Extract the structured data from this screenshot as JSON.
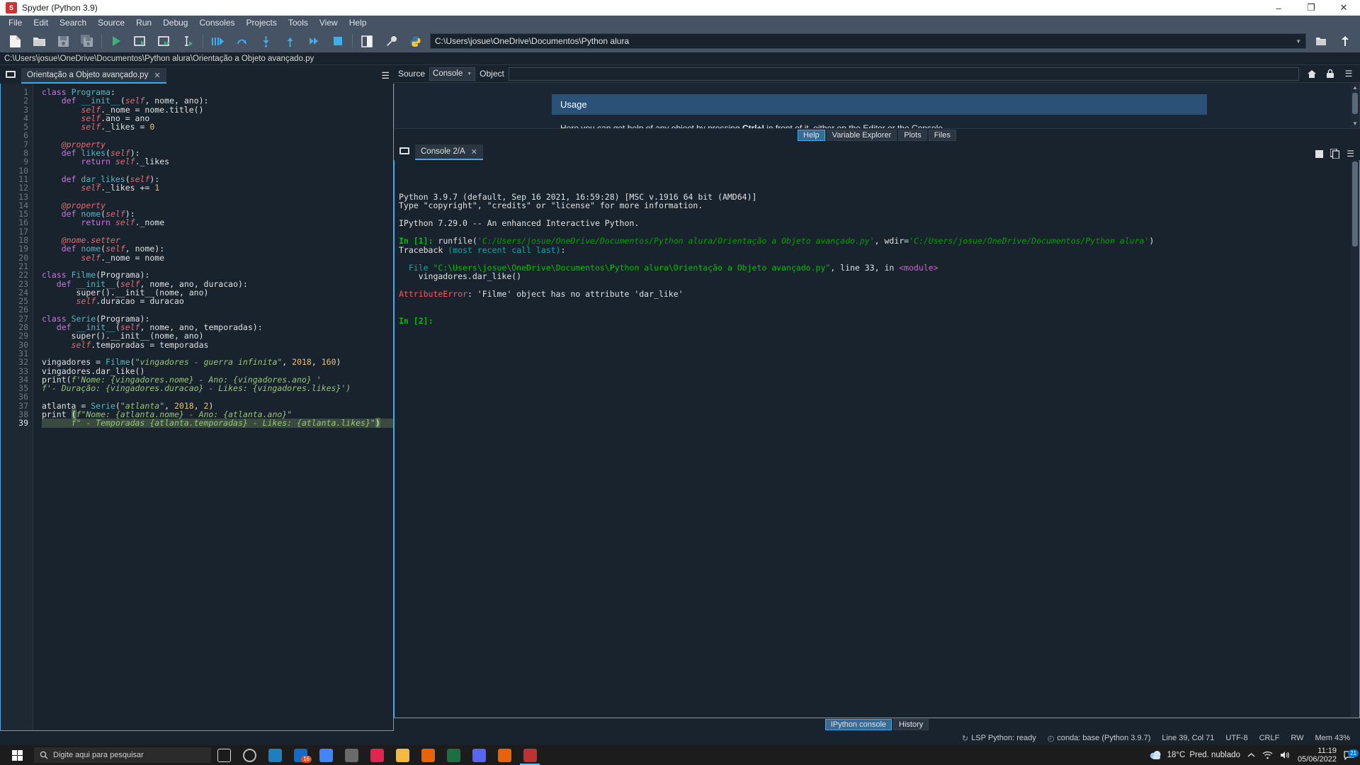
{
  "window": {
    "title": "Spyder (Python 3.9)",
    "app_icon": "spyder-icon",
    "minimize_label": "–",
    "maximize_label": "❐",
    "close_label": "✕"
  },
  "menubar": {
    "items": [
      "File",
      "Edit",
      "Search",
      "Source",
      "Run",
      "Debug",
      "Consoles",
      "Projects",
      "Tools",
      "View",
      "Help"
    ]
  },
  "toolbar": {
    "buttons": [
      {
        "name": "new-file-icon",
        "title": "New file"
      },
      {
        "name": "open-file-icon",
        "title": "Open file"
      },
      {
        "name": "save-file-icon",
        "title": "Save file"
      },
      {
        "name": "save-all-icon",
        "title": "Save all"
      },
      {
        "name": "run-file-icon",
        "title": "Run file"
      },
      {
        "name": "run-cell-icon",
        "title": "Run cell"
      },
      {
        "name": "run-cell-advance-icon",
        "title": "Run cell and advance"
      },
      {
        "name": "run-selection-icon",
        "title": "Run selection"
      },
      {
        "name": "debug-file-icon",
        "title": "Debug file"
      },
      {
        "name": "step-over-icon",
        "title": "Run current line"
      },
      {
        "name": "step-into-icon",
        "title": "Step into function"
      },
      {
        "name": "step-return-icon",
        "title": "Run until exit"
      },
      {
        "name": "continue-icon",
        "title": "Continue execution"
      },
      {
        "name": "stop-debug-icon",
        "title": "Stop debugging"
      },
      {
        "name": "maximize-pane-icon",
        "title": "Maximize current pane"
      },
      {
        "name": "preferences-icon",
        "title": "Preferences"
      },
      {
        "name": "python-path-icon",
        "title": "PYTHONPATH manager"
      }
    ],
    "path_value": "C:\\Users\\josue\\OneDrive\\Documentos\\Python alura",
    "browse_icon": "folder-icon",
    "parent_dir_icon": "arrow-up-icon",
    "dropdown_icon": "chevron-down-icon"
  },
  "editor": {
    "filepath": "C:\\Users\\josue\\OneDrive\\Documentos\\Python alura\\Orientação a Objeto avançado.py",
    "browse_tabs_icon": "browse-tabs-icon",
    "options_icon": "hamburger-icon",
    "tab": {
      "label": "Orientação a Objeto avançado.py",
      "close": "✕"
    },
    "lines": [
      {
        "n": 1,
        "tokens": [
          [
            "kw",
            "class"
          ],
          [
            "op",
            " "
          ],
          [
            "cls",
            "Programa"
          ],
          [
            "op",
            ":"
          ]
        ]
      },
      {
        "n": 2,
        "tokens": [
          [
            "op",
            "    "
          ],
          [
            "kw",
            "def"
          ],
          [
            "op",
            " "
          ],
          [
            "fn",
            "__init__"
          ],
          [
            "op",
            "("
          ],
          [
            "self",
            "self"
          ],
          [
            "op",
            ", nome, ano):"
          ]
        ]
      },
      {
        "n": 3,
        "tokens": [
          [
            "op",
            "        "
          ],
          [
            "self",
            "self"
          ],
          [
            "op",
            "._nome = nome.title()"
          ]
        ]
      },
      {
        "n": 4,
        "tokens": [
          [
            "op",
            "        "
          ],
          [
            "self",
            "self"
          ],
          [
            "op",
            ".ano = ano"
          ]
        ]
      },
      {
        "n": 5,
        "tokens": [
          [
            "op",
            "        "
          ],
          [
            "self",
            "self"
          ],
          [
            "op",
            "._likes = "
          ],
          [
            "num",
            "0"
          ]
        ]
      },
      {
        "n": 6,
        "tokens": []
      },
      {
        "n": 7,
        "tokens": [
          [
            "op",
            "    "
          ],
          [
            "dec",
            "@property"
          ]
        ]
      },
      {
        "n": 8,
        "tokens": [
          [
            "op",
            "    "
          ],
          [
            "kw",
            "def"
          ],
          [
            "op",
            " "
          ],
          [
            "fn",
            "likes"
          ],
          [
            "op",
            "("
          ],
          [
            "self",
            "self"
          ],
          [
            "op",
            "):"
          ]
        ]
      },
      {
        "n": 9,
        "tokens": [
          [
            "op",
            "        "
          ],
          [
            "kw",
            "return"
          ],
          [
            "op",
            " "
          ],
          [
            "self",
            "self"
          ],
          [
            "op",
            "._likes"
          ]
        ]
      },
      {
        "n": 10,
        "tokens": []
      },
      {
        "n": 11,
        "tokens": [
          [
            "op",
            "    "
          ],
          [
            "kw",
            "def"
          ],
          [
            "op",
            " "
          ],
          [
            "fn",
            "dar_likes"
          ],
          [
            "op",
            "("
          ],
          [
            "self",
            "self"
          ],
          [
            "op",
            "):"
          ]
        ]
      },
      {
        "n": 12,
        "tokens": [
          [
            "op",
            "        "
          ],
          [
            "self",
            "self"
          ],
          [
            "op",
            "._likes += "
          ],
          [
            "num",
            "1"
          ]
        ]
      },
      {
        "n": 13,
        "tokens": []
      },
      {
        "n": 14,
        "tokens": [
          [
            "op",
            "    "
          ],
          [
            "dec",
            "@property"
          ]
        ]
      },
      {
        "n": 15,
        "tokens": [
          [
            "op",
            "    "
          ],
          [
            "kw",
            "def"
          ],
          [
            "op",
            " "
          ],
          [
            "fn",
            "nome"
          ],
          [
            "op",
            "("
          ],
          [
            "self",
            "self"
          ],
          [
            "op",
            "):"
          ]
        ]
      },
      {
        "n": 16,
        "tokens": [
          [
            "op",
            "        "
          ],
          [
            "kw",
            "return"
          ],
          [
            "op",
            " "
          ],
          [
            "self",
            "self"
          ],
          [
            "op",
            "._nome"
          ]
        ]
      },
      {
        "n": 17,
        "tokens": []
      },
      {
        "n": 18,
        "tokens": [
          [
            "op",
            "    "
          ],
          [
            "dec",
            "@nome.setter"
          ]
        ]
      },
      {
        "n": 19,
        "tokens": [
          [
            "op",
            "    "
          ],
          [
            "kw",
            "def"
          ],
          [
            "op",
            " "
          ],
          [
            "fn",
            "nome"
          ],
          [
            "op",
            "("
          ],
          [
            "self",
            "self"
          ],
          [
            "op",
            ", nome):"
          ]
        ]
      },
      {
        "n": 20,
        "tokens": [
          [
            "op",
            "        "
          ],
          [
            "self",
            "self"
          ],
          [
            "op",
            "._nome = nome"
          ]
        ]
      },
      {
        "n": 21,
        "tokens": []
      },
      {
        "n": 22,
        "tokens": [
          [
            "kw",
            "class"
          ],
          [
            "op",
            " "
          ],
          [
            "cls",
            "Filme"
          ],
          [
            "op",
            "(Programa):"
          ]
        ]
      },
      {
        "n": 23,
        "tokens": [
          [
            "op",
            "   "
          ],
          [
            "kw",
            "def"
          ],
          [
            "op",
            " "
          ],
          [
            "fn",
            "__init__"
          ],
          [
            "op",
            "("
          ],
          [
            "self",
            "self"
          ],
          [
            "op",
            ", nome, ano, duracao):"
          ]
        ]
      },
      {
        "n": 24,
        "tokens": [
          [
            "op",
            "       "
          ],
          [
            "bi",
            "super"
          ],
          [
            "op",
            "().__init__(nome, ano)"
          ]
        ]
      },
      {
        "n": 25,
        "tokens": [
          [
            "op",
            "       "
          ],
          [
            "self",
            "self"
          ],
          [
            "op",
            ".duracao = duracao"
          ]
        ]
      },
      {
        "n": 26,
        "tokens": []
      },
      {
        "n": 27,
        "tokens": [
          [
            "kw",
            "class"
          ],
          [
            "op",
            " "
          ],
          [
            "cls",
            "Serie"
          ],
          [
            "op",
            "(Programa):"
          ]
        ]
      },
      {
        "n": 28,
        "tokens": [
          [
            "op",
            "   "
          ],
          [
            "kw",
            "def"
          ],
          [
            "op",
            " "
          ],
          [
            "fn",
            "__init__"
          ],
          [
            "op",
            "("
          ],
          [
            "self",
            "self"
          ],
          [
            "op",
            ", nome, ano, temporadas):"
          ]
        ]
      },
      {
        "n": 29,
        "tokens": [
          [
            "op",
            "      "
          ],
          [
            "bi",
            "super"
          ],
          [
            "op",
            "().__init__(nome, ano)"
          ]
        ]
      },
      {
        "n": 30,
        "tokens": [
          [
            "op",
            "      "
          ],
          [
            "self",
            "self"
          ],
          [
            "op",
            ".temporadas = temporadas"
          ]
        ]
      },
      {
        "n": 31,
        "tokens": []
      },
      {
        "n": 32,
        "tokens": [
          [
            "op",
            "vingadores = "
          ],
          [
            "cls",
            "Filme"
          ],
          [
            "op",
            "("
          ],
          [
            "str",
            "\"vingadores - guerra infinita\""
          ],
          [
            "op",
            ", "
          ],
          [
            "num",
            "2018"
          ],
          [
            "op",
            ", "
          ],
          [
            "num",
            "160"
          ],
          [
            "op",
            ")"
          ]
        ]
      },
      {
        "n": 33,
        "tokens": [
          [
            "op",
            "vingadores.dar_like()"
          ]
        ]
      },
      {
        "n": 34,
        "tokens": [
          [
            "bi",
            "print"
          ],
          [
            "op",
            "("
          ],
          [
            "str",
            "f'Nome: {vingadores.nome} - Ano: {vingadores.ano} '"
          ]
        ]
      },
      {
        "n": 35,
        "tokens": [
          [
            "str",
            "f'- Duração: {vingadores.duracao} - Likes: {vingadores.likes}')"
          ]
        ]
      },
      {
        "n": 36,
        "tokens": []
      },
      {
        "n": 37,
        "tokens": [
          [
            "op",
            "atlanta = "
          ],
          [
            "cls",
            "Serie"
          ],
          [
            "op",
            "("
          ],
          [
            "str",
            "\"atlanta\""
          ],
          [
            "op",
            ", "
          ],
          [
            "num",
            "2018"
          ],
          [
            "op",
            ", "
          ],
          [
            "num",
            "2"
          ],
          [
            "op",
            ")"
          ]
        ]
      },
      {
        "n": 38,
        "tokens": [
          [
            "bi",
            "print"
          ],
          [
            "op",
            " "
          ],
          [
            "hl",
            "("
          ],
          [
            "str",
            "f\"Nome: {atlanta.nome} - Ano: {atlanta.ano}\""
          ]
        ]
      },
      {
        "n": 39,
        "tokens": [
          [
            "op",
            "      "
          ],
          [
            "str",
            "f\" - Temporadas {atlanta.temporadas} - Likes: {atlanta.likes}\""
          ],
          [
            "hl",
            ")"
          ]
        ],
        "current": true
      }
    ]
  },
  "help_pane": {
    "source_label": "Source",
    "source_value": "Console",
    "object_label": "Object",
    "object_value": "",
    "object_placeholder": "",
    "home_icon": "home-icon",
    "lock_icon": "lock-icon",
    "options_icon": "hamburger-icon",
    "usage_title": "Usage",
    "usage_text_before": "Here you can get help of any object by pressing ",
    "usage_shortcut": "Ctrl+I",
    "usage_text_after": " in front of it, either on the Editor or the Console.",
    "tabs": [
      {
        "label": "Help",
        "active": true
      },
      {
        "label": "Variable Explorer",
        "active": false
      },
      {
        "label": "Plots",
        "active": false
      },
      {
        "label": "Files",
        "active": false
      }
    ]
  },
  "console": {
    "browse_tabs_icon": "browse-tabs-icon",
    "tab": {
      "label": "Console 2/A",
      "close": "✕"
    },
    "stop_icon": "stop-icon",
    "copy_icon": "copy-icon",
    "options_icon": "hamburger-icon",
    "lines": [
      [
        [
          "c-white",
          "Python 3.9.7 (default, Sep 16 2021, 16:59:28) [MSC v.1916 64 bit (AMD64)]"
        ]
      ],
      [
        [
          "c-white",
          "Type \"copyright\", \"credits\" or \"license\" for more information."
        ]
      ],
      [],
      [
        [
          "c-white",
          "IPython 7.29.0 -- An enhanced Interactive Python."
        ]
      ],
      [],
      [
        [
          "c-green-b",
          "In ["
        ],
        [
          "c-green-b",
          "1"
        ],
        [
          "c-green-b",
          "]:"
        ],
        [
          "c-white",
          " runfile("
        ],
        [
          "c-str-green",
          "'C:/Users/josue/OneDrive/Documentos/Python alura/Orientação a Objeto avançado.py'"
        ],
        [
          "c-white",
          ", wdir="
        ],
        [
          "c-str-green",
          "'C:/Users/josue/OneDrive/Documentos/Python alura'"
        ],
        [
          "c-white",
          ")"
        ]
      ],
      [
        [
          "c-white",
          "Traceback "
        ],
        [
          "c-cyan",
          "(most recent call last)"
        ],
        [
          "c-white",
          ":"
        ]
      ],
      [],
      [
        [
          "c-white",
          "  "
        ],
        [
          "c-cyan",
          "File "
        ],
        [
          "c-green",
          "\"C:\\Users\\josue\\OneDrive\\Documentos\\Python alura\\Orientação a Objeto avançado.py\""
        ],
        [
          "c-white",
          ", line 33, in "
        ],
        [
          "c-magenta",
          "<module>"
        ]
      ],
      [
        [
          "c-white",
          "    vingadores.dar_like()"
        ]
      ],
      [],
      [
        [
          "c-red",
          "AttributeError"
        ],
        [
          "c-white",
          ": 'Filme' object has no attribute 'dar_like'"
        ]
      ],
      [],
      [],
      [
        [
          "c-green-b",
          "In ["
        ],
        [
          "c-green-b",
          "2"
        ],
        [
          "c-green-b",
          "]:"
        ]
      ]
    ],
    "tabs": [
      {
        "label": "IPython console",
        "active": true
      },
      {
        "label": "History",
        "active": false
      }
    ]
  },
  "statusbar": {
    "items": [
      {
        "name": "lsp-status",
        "icon": "refresh-icon",
        "text": "LSP Python: ready"
      },
      {
        "name": "conda-status",
        "icon": "clock-icon",
        "text": "conda: base (Python 3.9.7)"
      },
      {
        "name": "cursor-position",
        "icon": "",
        "text": "Line 39, Col 71"
      },
      {
        "name": "file-encoding",
        "icon": "",
        "text": "UTF-8"
      },
      {
        "name": "eol-status",
        "icon": "",
        "text": "CRLF"
      },
      {
        "name": "read-write-status",
        "icon": "",
        "text": "RW"
      },
      {
        "name": "memory-status",
        "icon": "",
        "text": "Mem 43%"
      }
    ]
  },
  "taskbar": {
    "search_placeholder": "Digite aqui para pesquisar",
    "apps": [
      {
        "name": "task-view",
        "color": "#3a3a3a",
        "badge": ""
      },
      {
        "name": "cortana-circle",
        "color": "#2a2a2a",
        "badge": ""
      },
      {
        "name": "app-edge",
        "color": "#1f7ec0",
        "badge": ""
      },
      {
        "name": "app-mail",
        "color": "#1569c7",
        "badge": "16"
      },
      {
        "name": "app-chrome",
        "color": "#4285f4",
        "badge": ""
      },
      {
        "name": "app-store",
        "color": "#6a6a6a",
        "badge": ""
      },
      {
        "name": "app-opera",
        "color": "#e0264d",
        "badge": ""
      },
      {
        "name": "app-explorer",
        "color": "#f5b942",
        "badge": ""
      },
      {
        "name": "app-vlc",
        "color": "#e8640a",
        "badge": ""
      },
      {
        "name": "app-excel",
        "color": "#1d6f42",
        "badge": ""
      },
      {
        "name": "app-discord",
        "color": "#5865f2",
        "badge": ""
      },
      {
        "name": "app-firefox",
        "color": "#e8640a",
        "badge": ""
      },
      {
        "name": "app-spyder",
        "color": "#b33",
        "badge": "",
        "active": true
      }
    ],
    "weather_temp": "18°C",
    "weather_desc": "Pred. nublado",
    "weather_icon": "cloud-icon",
    "chevron_icon": "chevron-up-icon",
    "network_icon": "wifi-icon",
    "sound_icon": "speaker-icon",
    "time": "11:19",
    "date": "05/06/2022",
    "notification_icon": "notification-icon",
    "notification_count": "21"
  }
}
